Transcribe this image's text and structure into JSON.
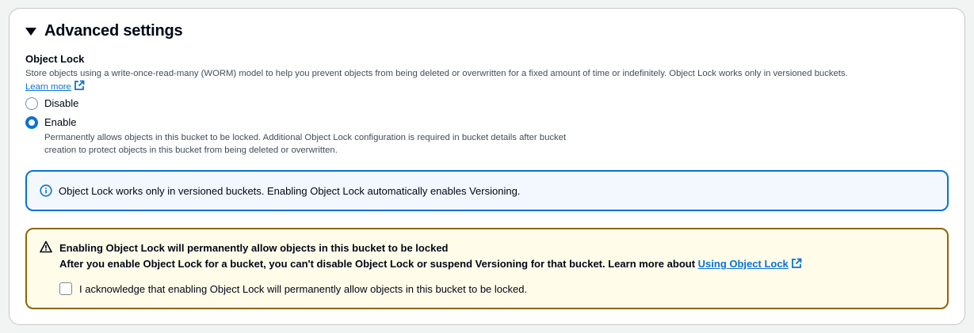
{
  "section": {
    "title": "Advanced settings",
    "expanded": true
  },
  "object_lock": {
    "label": "Object Lock",
    "description": "Store objects using a write-once-read-many (WORM) model to help you prevent objects from being deleted or overwritten for a fixed amount of time or indefinitely. Object Lock works only in versioned buckets.",
    "learn_more": "Learn more",
    "options": [
      {
        "label": "Disable",
        "checked": false
      },
      {
        "label": "Enable",
        "checked": true,
        "description_line1": "Permanently allows objects in this bucket to be locked. Additional Object Lock configuration is required in bucket details after bucket",
        "description_line2": "creation to protect objects in this bucket from being deleted or overwritten."
      }
    ]
  },
  "info_alert": {
    "text": "Object Lock works only in versioned buckets. Enabling Object Lock automatically enables Versioning."
  },
  "warning_alert": {
    "title": "Enabling Object Lock will permanently allow objects in this bucket to be locked",
    "body": "After you enable Object Lock for a bucket, you can't disable Object Lock or suspend Versioning for that bucket. Learn more about",
    "link": "Using Object Lock",
    "acknowledge": "I acknowledge that enabling Object Lock will permanently allow objects in this bucket to be locked.",
    "acknowledge_checked": false
  },
  "colors": {
    "link": "#0972d3",
    "info_border": "#0972d3",
    "info_bg": "#f2f8fd",
    "warning_border": "#8d6605",
    "warning_bg": "#fffce9"
  }
}
